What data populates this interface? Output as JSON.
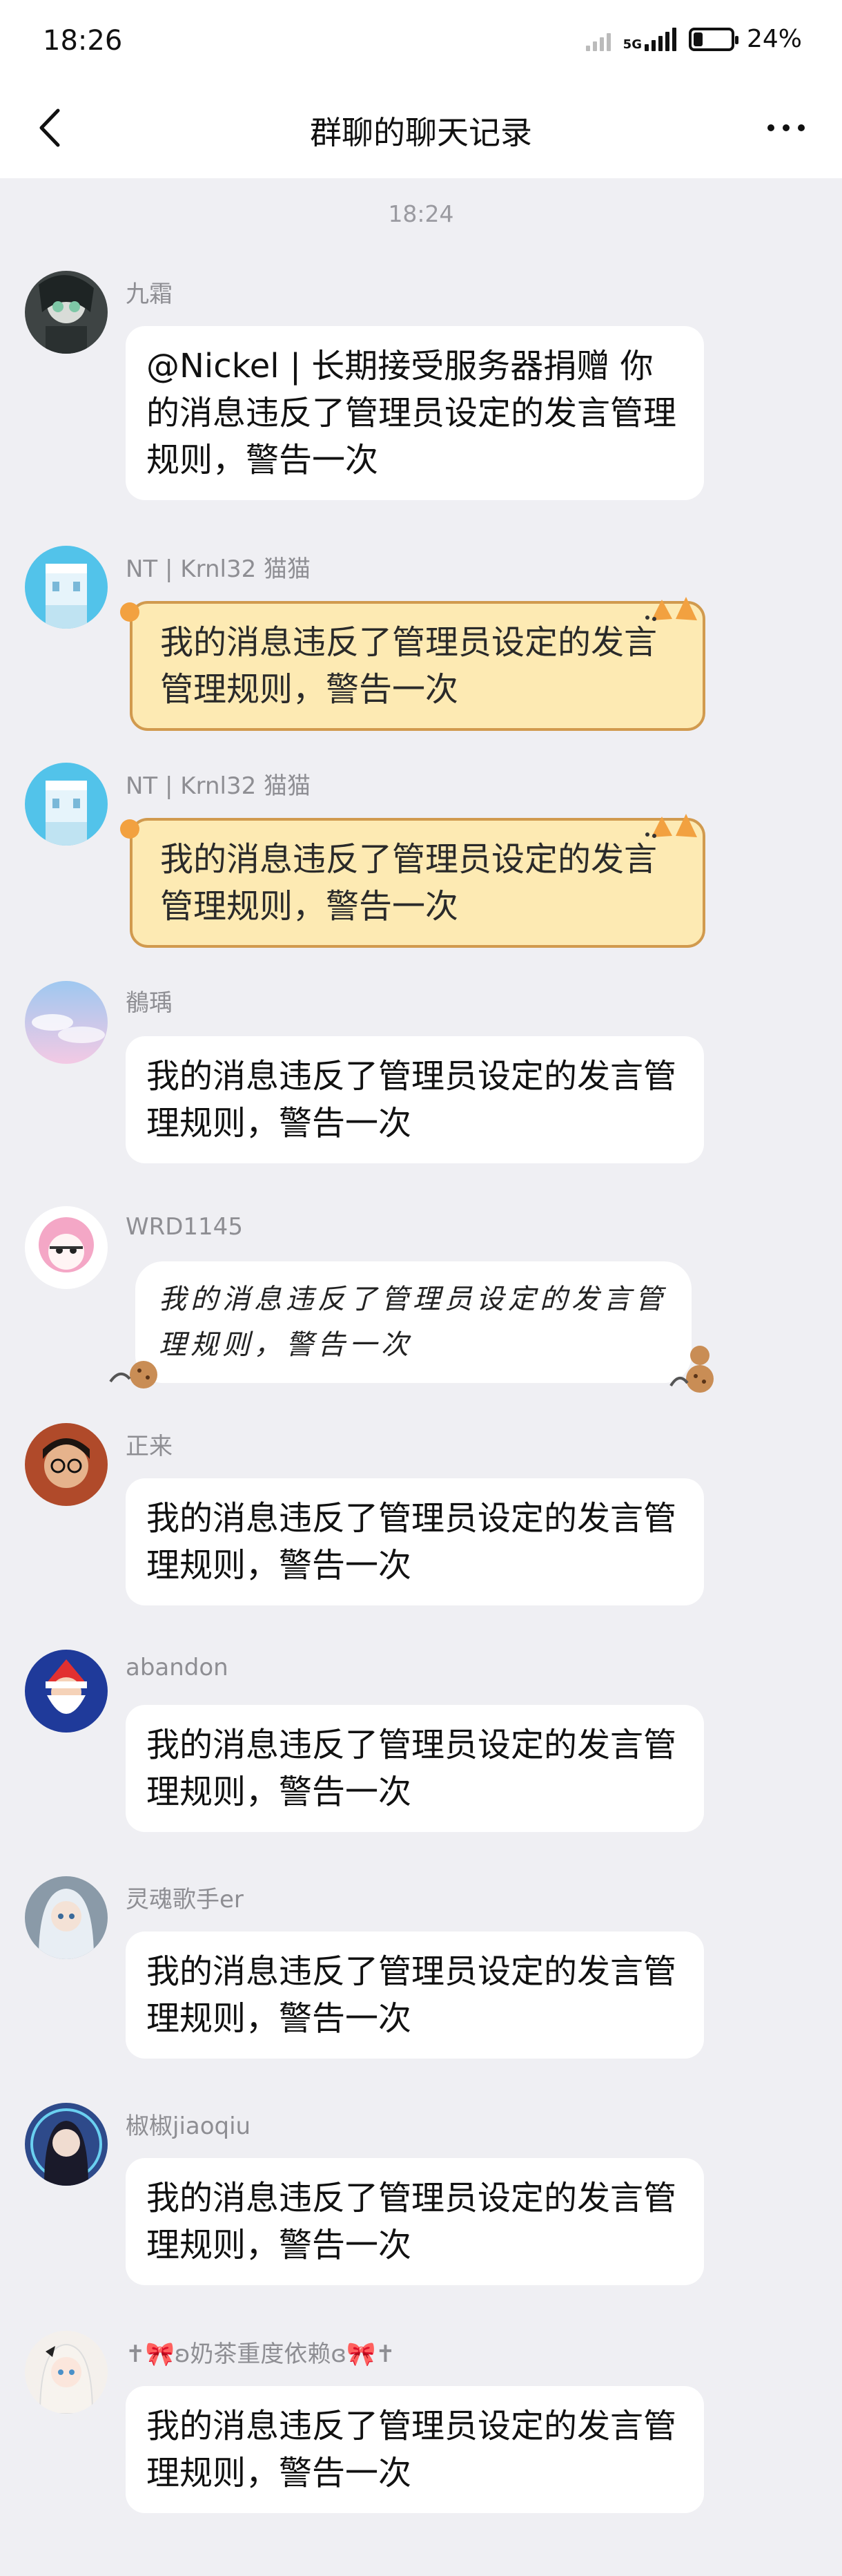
{
  "status_bar": {
    "time": "18:26",
    "network": "5G",
    "battery": "24%",
    "battery_level": 0.24
  },
  "header": {
    "title": "群聊的聊天记录",
    "back_icon": "chevron-left-icon",
    "more_icon": "more-dots-icon"
  },
  "chat": {
    "timestamp": "18:24",
    "messages": [
      {
        "sender": "九霜",
        "text": "@Nickel | 长期接受服务器捐赠 你的消息违反了管理员设定的发言管理规则，警告一次",
        "style": "normal"
      },
      {
        "sender": "NT | Krnl32 猫猫",
        "text": "我的消息违反了管理员设定的发言管理规则，警告一次",
        "style": "cat"
      },
      {
        "sender": "NT | Krnl32 猫猫",
        "text": "我的消息违反了管理员设定的发言管理规则，警告一次",
        "style": "cat"
      },
      {
        "sender": "鶺瑀",
        "text": "我的消息违反了管理员设定的发言管理规则，警告一次",
        "style": "normal"
      },
      {
        "sender": "WRD1145",
        "text": "我的消息违反了管理员设定的发言管理规则，警告一次",
        "style": "handwriting"
      },
      {
        "sender": "正来",
        "text": "我的消息违反了管理员设定的发言管理规则，警告一次",
        "style": "normal"
      },
      {
        "sender": "abandon",
        "text": "我的消息违反了管理员设定的发言管理规则，警告一次",
        "style": "normal"
      },
      {
        "sender": "灵魂歌手er",
        "text": "我的消息违反了管理员设定的发言管理规则，警告一次",
        "style": "normal"
      },
      {
        "sender": "椒椒jiaoqiu",
        "text": "我的消息违反了管理员设定的发言管理规则，警告一次",
        "style": "normal"
      },
      {
        "sender": "✝🎀ʚ奶茶重度依赖ɞ🎀✝",
        "text": "我的消息违反了管理员设定的发言管理规则，警告一次",
        "style": "normal"
      }
    ]
  },
  "colors": {
    "background": "#efeff3",
    "bubble": "#ffffff",
    "cat_bubble": "#fdeab3",
    "cat_border": "#d19a4e",
    "sender": "#8e8e93"
  }
}
